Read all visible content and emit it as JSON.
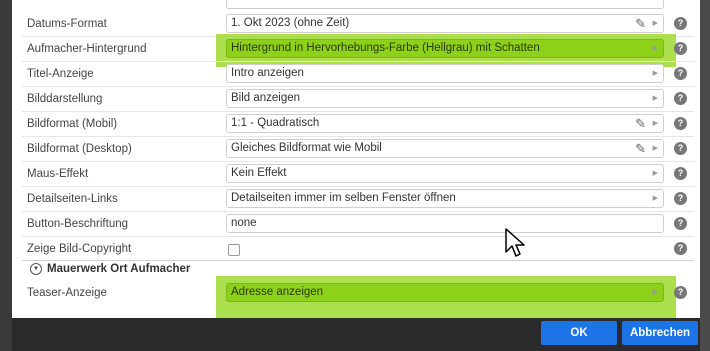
{
  "rows": [
    {
      "label": "Datums-Format",
      "value": "1. Okt 2023 (ohne Zeit)"
    },
    {
      "label": "Aufmacher-Hintergrund",
      "value": "Hintergrund in Hervorhebungs-Farbe (Hellgrau) mit Schatten"
    },
    {
      "label": "Titel-Anzeige",
      "value": "Intro anzeigen"
    },
    {
      "label": "Bilddarstellung",
      "value": "Bild anzeigen"
    },
    {
      "label": "Bildformat (Mobil)",
      "value": "1:1 - Quadratisch"
    },
    {
      "label": "Bildformat (Desktop)",
      "value": "Gleiches Bildformat wie Mobil"
    },
    {
      "label": "Maus-Effekt",
      "value": "Kein Effekt"
    },
    {
      "label": "Detailseiten-Links",
      "value": "Detailseiten immer im selben Fenster öffnen"
    },
    {
      "label": "Button-Beschriftung",
      "value": "none"
    },
    {
      "label": "Zeige Bild-Copyright",
      "value": ""
    }
  ],
  "section": {
    "title": "Mauerwerk Ort Aufmacher",
    "rows": [
      {
        "label": "Teaser-Anzeige",
        "value": "Adresse anzeigen"
      }
    ]
  },
  "icons": {
    "help": "question-circle-icon",
    "edit": "pencil-icon",
    "dropdown": "triangle-right-icon",
    "toggle": "chevron-down-icon"
  },
  "help_glyph": "?",
  "colors": {
    "highlight": "#8ed11a",
    "primary_button": "#1e74e6",
    "background_dark": "#2d2d2d"
  },
  "footer": {
    "ok_label": "OK",
    "cancel_label": "Abbrechen"
  }
}
